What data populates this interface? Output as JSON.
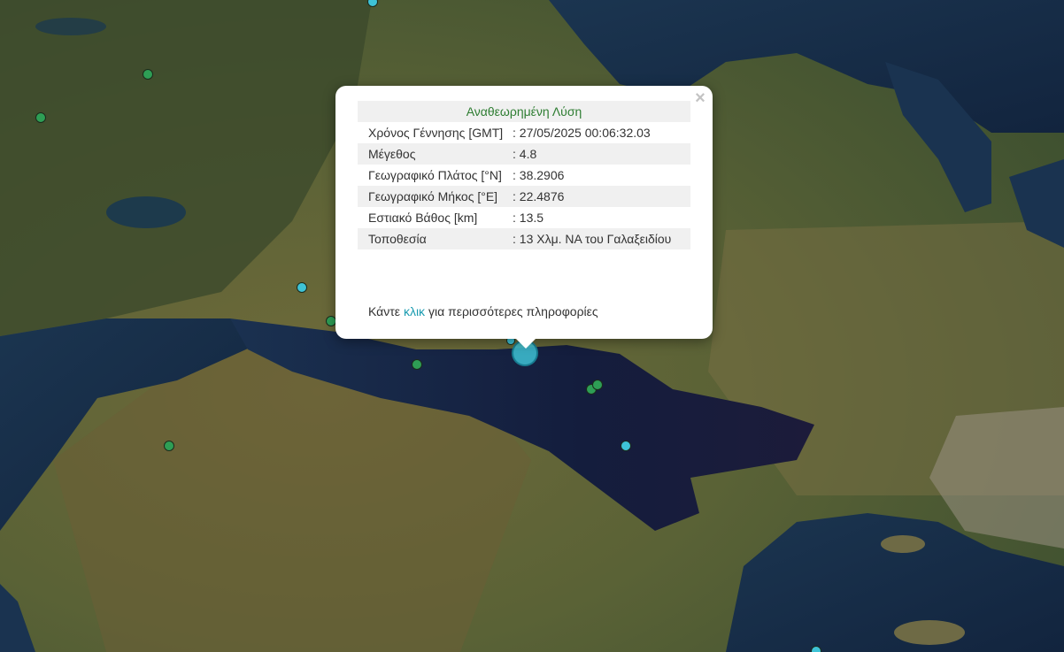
{
  "map": {
    "markers": [
      {
        "id": "m1",
        "color": "#3ec3d6",
        "kind": "cyan",
        "magnitude_class": "small"
      },
      {
        "id": "m2",
        "color": "#2e9e55",
        "kind": "green",
        "magnitude_class": "small"
      },
      {
        "id": "m3",
        "color": "#2e9e55",
        "kind": "green",
        "magnitude_class": "small"
      },
      {
        "id": "m4",
        "color": "#3ec3d6",
        "kind": "cyan",
        "magnitude_class": "small"
      },
      {
        "id": "m5",
        "color": "#2e9e55",
        "kind": "green",
        "magnitude_class": "small"
      },
      {
        "id": "m6",
        "color": "#2e9e55",
        "kind": "green",
        "magnitude_class": "small"
      },
      {
        "id": "m7",
        "color": "#2e9e55",
        "kind": "green",
        "magnitude_class": "small"
      },
      {
        "id": "m8",
        "color": "#2e9e55",
        "kind": "green",
        "magnitude_class": "small"
      },
      {
        "id": "m9",
        "color": "#2e9e55",
        "kind": "green",
        "magnitude_class": "small"
      },
      {
        "id": "m10",
        "color": "#3ec3d6",
        "kind": "cyan",
        "magnitude_class": "small"
      },
      {
        "id": "m11",
        "color": "#3ec3d6",
        "kind": "cyan",
        "magnitude_class": "small"
      },
      {
        "id": "m12",
        "color": "#3ec3d6",
        "kind": "cyan",
        "magnitude_class": "small"
      },
      {
        "id": "m-selected",
        "color": "#3ec3d6",
        "kind": "big",
        "magnitude_class": "selected"
      }
    ]
  },
  "popup": {
    "header": "Αναθεωρημένη Λύση",
    "close_glyph": "×",
    "rows": [
      {
        "label": "Χρόνος Γέννησης [GMT]",
        "value": ": 27/05/2025 00:06:32.03"
      },
      {
        "label": "Μέγεθος",
        "value": ": 4.8"
      },
      {
        "label": "Γεωγραφικό Πλάτος [°N]",
        "value": ": 38.2906"
      },
      {
        "label": "Γεωγραφικό Μήκος [°E]",
        "value": ": 22.4876"
      },
      {
        "label": "Εστιακό Βάθος [km]",
        "value": ": 13.5"
      },
      {
        "label": "Τοποθεσία",
        "value": ": 13 Χλμ. ΝΑ του Γαλαξειδίου"
      }
    ],
    "footer_prefix": "Κάντε",
    "footer_link": "κλικ",
    "footer_suffix": "για περισσότερες πληροφορίες"
  },
  "colors": {
    "header_green": "#2e7d32",
    "link_cyan": "#1a9bb0",
    "row_shade": "#f0f0f0"
  }
}
